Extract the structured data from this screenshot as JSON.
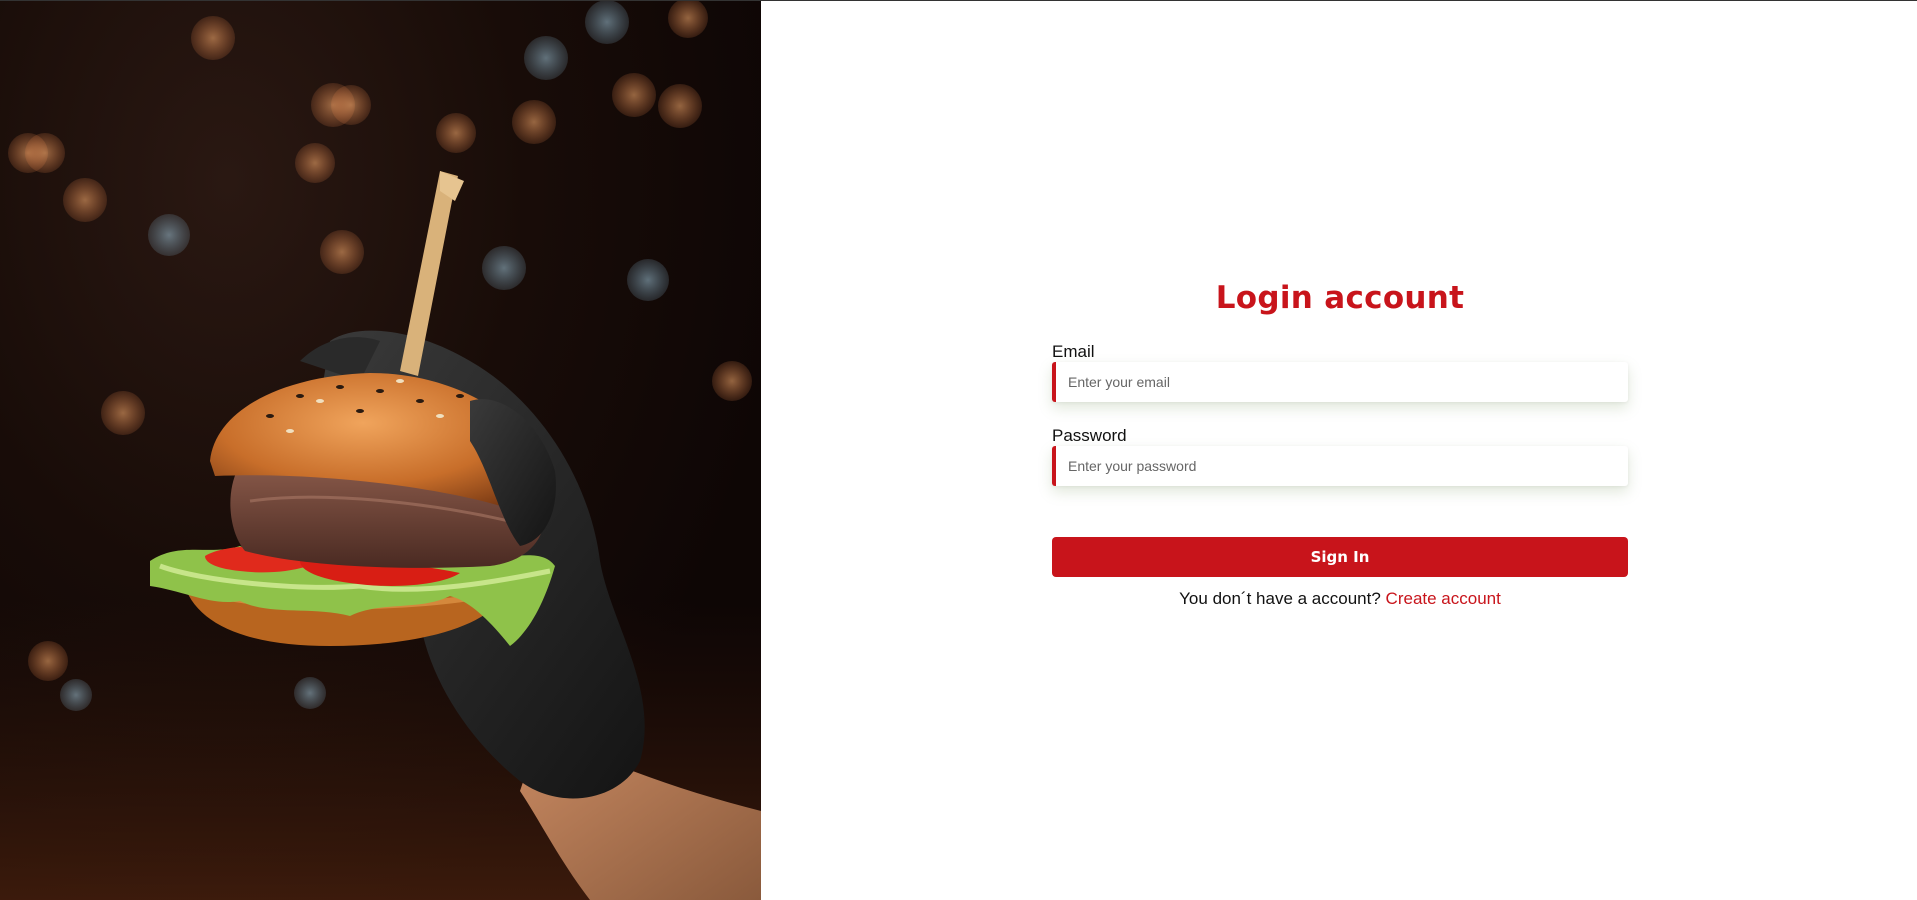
{
  "colors": {
    "accent": "#c8141b",
    "background": "#ffffff",
    "text": "#111111"
  },
  "hero": {
    "image_subject": "burger-held-in-black-gloved-hand"
  },
  "login": {
    "title": "Login account",
    "email": {
      "label": "Email",
      "placeholder": "Enter your email",
      "value": ""
    },
    "password": {
      "label": "Password",
      "placeholder": "Enter your password",
      "value": ""
    },
    "submit_label": "Sign In",
    "signup_prompt": "You don´t have a account?",
    "signup_link": "Create account"
  }
}
